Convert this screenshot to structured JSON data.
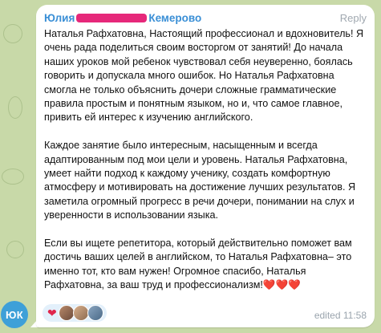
{
  "avatar": {
    "initials": "ЮК",
    "color": "#3ea0d8"
  },
  "message": {
    "sender_first": "Юлия",
    "sender_city": "Кемерово",
    "reply_label": "Reply",
    "paragraphs": [
      "Наталья Рафхатовна, Настоящий профессионал и вдохновитель! Я очень рада поделиться своим восторгом от занятий! До начала наших уроков мой ребенок чувствовал себя неуверенно, боялась говорить и допускала много ошибок. Но Наталья Рафхатовна смогла не только объяснить дочери сложные грамматические правила простым и понятным языком, но и, что самое главное, привить ей интерес к изучению английского.",
      "Каждое занятие было интересным, насыщенным и всегда адаптированным под мои цели и уровень. Наталья Рафхатовна, умеет найти подход к каждому ученику, создать комфортную атмосферу и мотивировать на достижение лучших результатов. Я заметила огромный прогресс в речи дочери, понимании на слух и уверенности в использовании языка.",
      "Если вы ищете репетитора, который действительно поможет вам достичь ваших целей в английском, то Наталья Рафхатовна– это именно тот, кто вам нужен! Огромное спасибо, Наталья Рафхатовна, за ваш труд и профессионализм!❤️❤️❤️"
    ],
    "reaction_emoji": "❤",
    "status": "edited 11:58"
  },
  "colors": {
    "sender": "#3a8fd6",
    "redaction": "#e6287a",
    "wallpaper": "#c8d9a8"
  }
}
